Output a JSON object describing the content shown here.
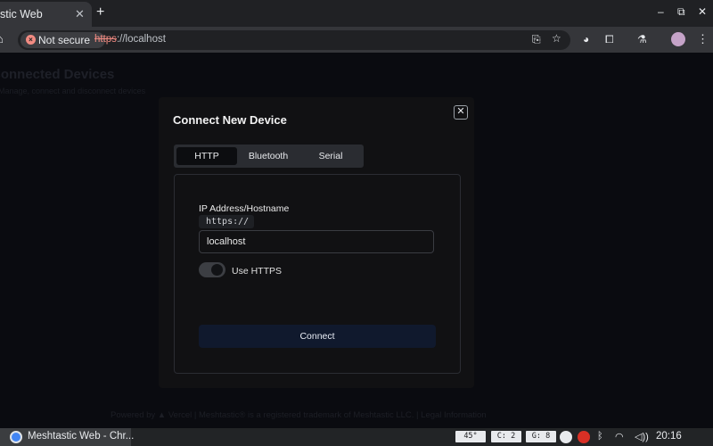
{
  "browser": {
    "tab_title": "stic Web",
    "tab_close": "✕",
    "new_tab": "+",
    "window_controls": {
      "minimize": "–",
      "restore": "⧉",
      "close": "✕"
    },
    "security_label": "Not secure",
    "url_scheme": "https",
    "url_rest": "://localhost",
    "toolbar_icons": [
      "install-app-icon",
      "star-icon",
      "extension-icon",
      "puzzle-icon",
      "labs-icon",
      "profile-icon",
      "menu-icon"
    ]
  },
  "page": {
    "heading": "Connected Devices",
    "subheading": "Manage, connect and disconnect devices",
    "footer": "Powered by ▲ Vercel | Meshtastic® is a registered trademark of Meshtastic LLC. | Legal Information"
  },
  "dialog": {
    "title": "Connect New Device",
    "close_glyph": "✕",
    "tabs": [
      {
        "label": "HTTP",
        "active": true
      },
      {
        "label": "Bluetooth",
        "active": false
      },
      {
        "label": "Serial",
        "active": false
      }
    ],
    "field_label": "IP Address/Hostname",
    "prefix": "https://",
    "host_value": "localhost",
    "https_label": "Use HTTPS",
    "https_enabled": false,
    "connect_label": "Connect"
  },
  "shelf": {
    "app_label": "Meshtastic Web - Chr...",
    "indicators": [
      "45°",
      "C:  2",
      "G:  8"
    ],
    "clock": "20:16"
  },
  "colors": {
    "dialog_bg": "#111113",
    "connect_button": "#10192d",
    "insecure_red": "#f28b82"
  }
}
